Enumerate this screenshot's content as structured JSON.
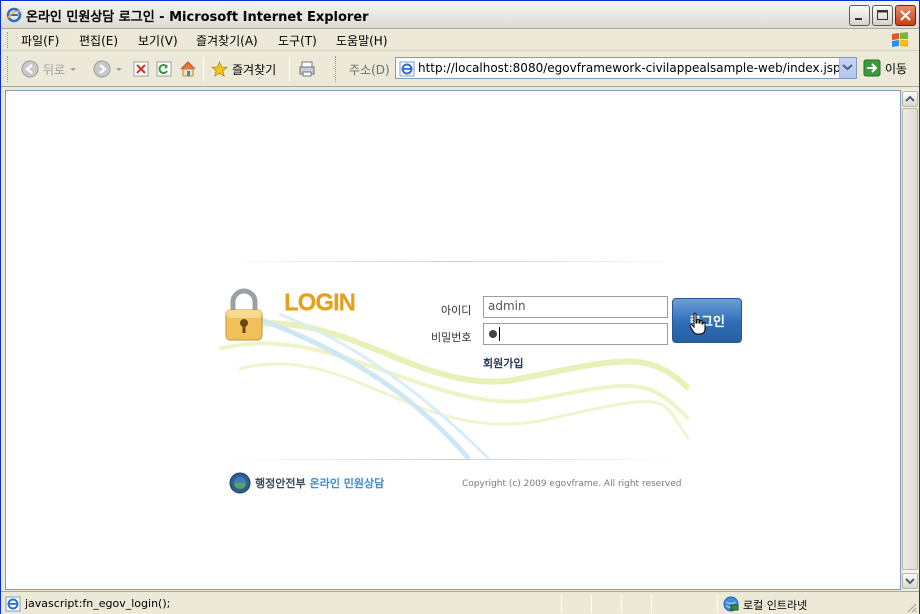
{
  "window": {
    "title": "온라인 민원상담 로그인 - Microsoft Internet Explorer"
  },
  "menu": {
    "items": [
      "파일(F)",
      "편집(E)",
      "보기(V)",
      "즐겨찾기(A)",
      "도구(T)",
      "도움말(H)"
    ]
  },
  "toolbar": {
    "back_label": "뒤로",
    "favorites_label": "즐겨찾기",
    "address_label": "주소(D)",
    "address_url": "http://localhost:8080/egovframework-civilappealsample-web/index.jsp",
    "go_label": "이동"
  },
  "login": {
    "title": "LOGIN",
    "id_label": "아이디",
    "id_value": "admin",
    "pw_label": "비밀번호",
    "login_button": "로그인",
    "signup_link": "회원가입",
    "ministry": "행정안전부",
    "service": "온라인 민원상담",
    "copyright": "Copyright (c) 2009 egovframe. All right reserved"
  },
  "statusbar": {
    "text": "javascript:fn_egov_login();",
    "zone": "로컬 인트라넷"
  },
  "colors": {
    "accent": "#e3a11b",
    "button": "#2f6db8",
    "title_bar": "#dcdbd3"
  }
}
